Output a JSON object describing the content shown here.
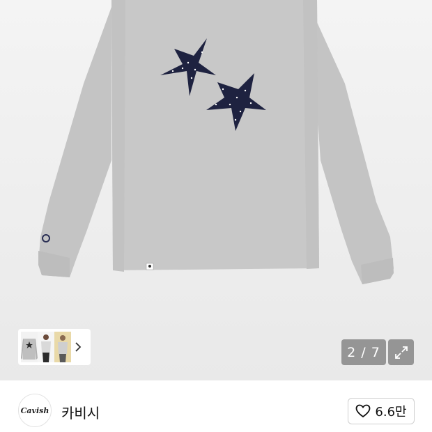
{
  "viewer": {
    "counter_text": "2 / 7",
    "thumb_more_icon": "chevron-right-icon",
    "expand_icon": "expand-icon"
  },
  "shop": {
    "logo_text": "Cavish",
    "name": "카비시",
    "like_icon": "heart-outline-icon",
    "like_count": "6.6만"
  }
}
